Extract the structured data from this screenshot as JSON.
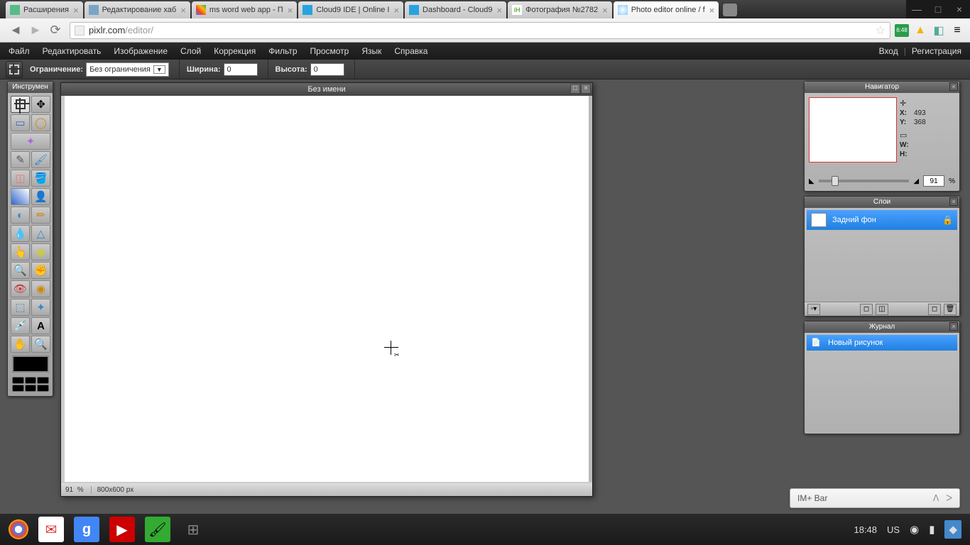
{
  "browser": {
    "tabs": [
      {
        "title": "Расширения",
        "favicon": "fav-ext"
      },
      {
        "title": "Редактирование хаб",
        "favicon": "fav-habr"
      },
      {
        "title": "ms word web app - П",
        "favicon": "fav-google"
      },
      {
        "title": "Cloud9 IDE | Online I",
        "favicon": "fav-c9"
      },
      {
        "title": "Dashboard - Cloud9",
        "favicon": "fav-c9"
      },
      {
        "title": "Фотография №2782",
        "favicon": "fav-ih",
        "favtext": "iH"
      },
      {
        "title": "Photo editor online / f",
        "favicon": "fav-pixlr",
        "active": true
      }
    ],
    "url_host": "pixlr.com",
    "url_path": "/editor/"
  },
  "menubar": {
    "items": [
      "Файл",
      "Редактировать",
      "Изображение",
      "Слой",
      "Коррекция",
      "Фильтр",
      "Просмотр",
      "Язык",
      "Справка"
    ],
    "right": [
      "Вход",
      "Регистрация"
    ]
  },
  "options": {
    "constraint_label": "Ограничение:",
    "constraint_value": "Без ограничения",
    "width_label": "Ширина:",
    "width_value": "0",
    "height_label": "Высота:",
    "height_value": "0"
  },
  "tools_panel": {
    "title": "Инструмен"
  },
  "document": {
    "title": "Без имени",
    "zoom": "91",
    "zoom_unit": "%",
    "dimensions": "800x600 px"
  },
  "navigator": {
    "title": "Навигатор",
    "x_label": "X:",
    "x_value": "493",
    "y_label": "Y:",
    "y_value": "368",
    "w_label": "W:",
    "w_value": "",
    "h_label": "H:",
    "h_value": "",
    "zoom_value": "91",
    "zoom_unit": "%"
  },
  "layers": {
    "title": "Слои",
    "items": [
      {
        "name": "Задний фон"
      }
    ]
  },
  "history": {
    "title": "Журнал",
    "items": [
      {
        "name": "Новый рисунок"
      }
    ]
  },
  "im_bar": {
    "label": "IM+ Bar"
  },
  "taskbar": {
    "time": "18:48",
    "lang": "US"
  }
}
